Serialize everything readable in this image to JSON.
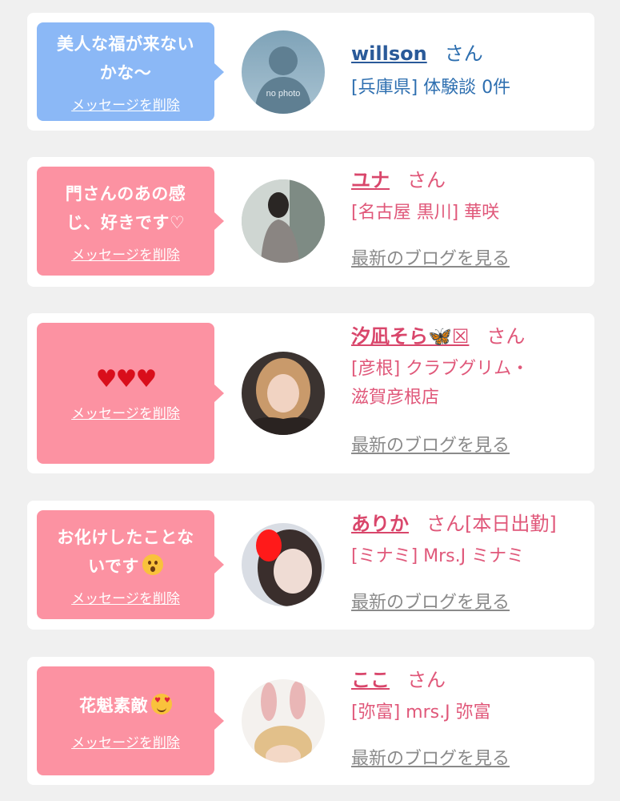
{
  "delete_label": "メッセージを削除",
  "san_label": "さん",
  "blog_label": "最新のブログを見る",
  "items": [
    {
      "message": "美人な福が来ない\nかな〜",
      "name": "willson",
      "status": "",
      "details": "[兵庫県] 体験談 0件",
      "avatar_caption": "no photo"
    },
    {
      "message": "門さんのあの感\nじ、好きです♡",
      "name": "ユナ",
      "status": "",
      "details": "[名古屋 黒川] 華咲"
    },
    {
      "message": "♥♥♥",
      "name": "汐凪そら🦋☒",
      "status": "",
      "details": "[彦根] クラブグリム・\n滋賀彦根店"
    },
    {
      "message": "お化けしたことな\nいです",
      "name": "ありか",
      "status": "[本日出勤]",
      "details": "[ミナミ] Mrs.J ミナミ"
    },
    {
      "message": "花魁素敵",
      "name": "ここ",
      "status": "",
      "details": "[弥富] mrs.J 弥富"
    }
  ],
  "icons": {
    "surprised": "surprised-face-emoji",
    "heart_eyes": "heart-eyes-emoji",
    "avatar_placeholder": "person-silhouette-icon"
  },
  "colors": {
    "blue_bubble": "#8bb8f6",
    "pink_bubble": "#fc92a2",
    "pink_text": "#e0587a",
    "blue_text": "#2e6fb0",
    "page_bg": "#f0f0f0"
  }
}
